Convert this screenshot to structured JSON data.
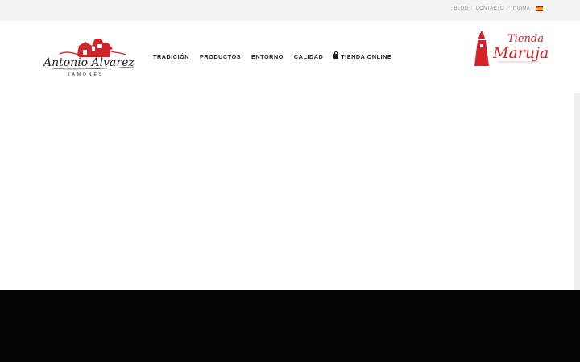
{
  "topbar": {
    "links": [
      "BLOG",
      "CONTACTO"
    ],
    "language_label": "IDIOMA:",
    "language_flag": "spain-flag-icon"
  },
  "logo": {
    "script_text": "Antonio Álvarez",
    "sub_text": "JAMONES"
  },
  "nav": {
    "items": [
      "TRADICIÓN",
      "PRODUCTOS",
      "ENTORNO",
      "CALIDAD"
    ],
    "shop_label": "TIENDA ONLINE",
    "shop_icon": "shopping-bag-icon"
  },
  "tienda_logo": {
    "line1": "Tienda",
    "line2": "Maruja"
  },
  "colors": {
    "brand_red": "#d3232a",
    "topbar_bg": "#f3f3f3",
    "footer_bg": "#050505",
    "nav_text": "#1c1c1c"
  }
}
